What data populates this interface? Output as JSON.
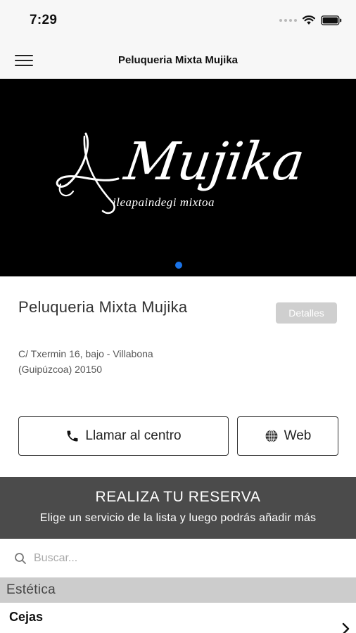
{
  "status_bar": {
    "time": "7:29"
  },
  "nav": {
    "title": "Peluqueria Mixta Mujika"
  },
  "hero": {
    "wordmark": "Mujika",
    "tagline": "ileapaindegi mixtoa"
  },
  "salon": {
    "name": "Peluqueria Mixta Mujika",
    "details_label": "Detalles",
    "address": "C/ Txermin 16, bajo - Villabona (Guipúzcoa) 20150"
  },
  "actions": {
    "call_label": "Llamar al centro",
    "web_label": "Web"
  },
  "booking": {
    "title": "REALIZA TU RESERVA",
    "subtitle": "Elige un servicio de la lista y luego podrás añadir más"
  },
  "search": {
    "placeholder": "Buscar..."
  },
  "categories": [
    {
      "name": "Estética",
      "services": [
        {
          "name": "Cejas"
        }
      ]
    }
  ],
  "colors": {
    "accent": "#1a73e8",
    "banner": "#4b4b4b",
    "category": "#cccccc"
  }
}
